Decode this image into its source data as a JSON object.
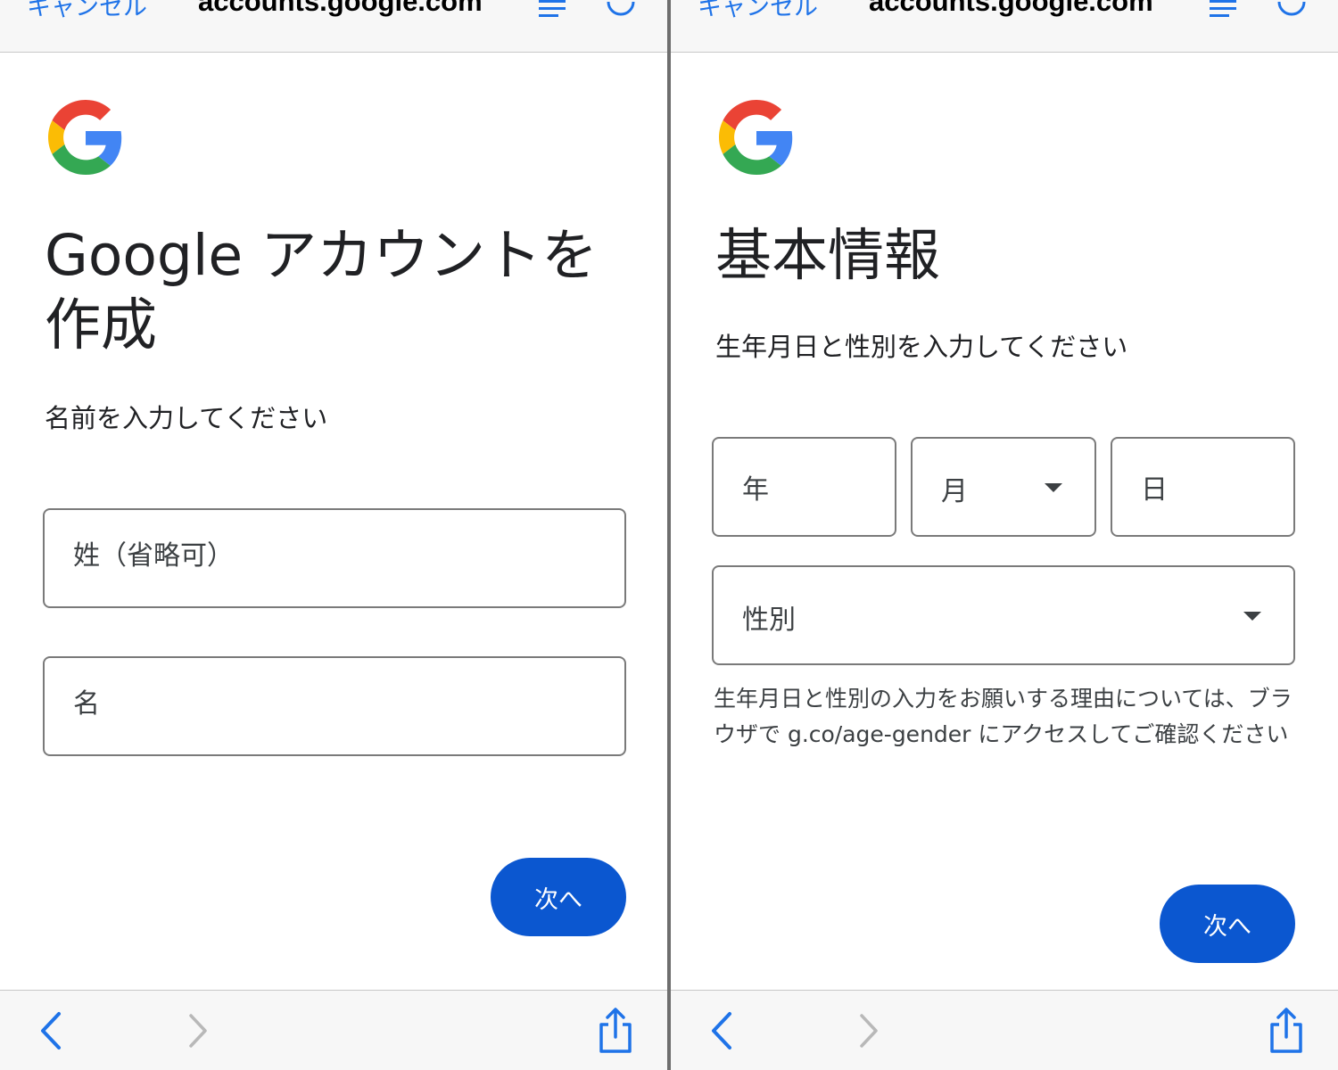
{
  "browser": {
    "cancel_label": "キャンセル",
    "url": "accounts.google.com",
    "accent_color": "#1f73e8",
    "icons": [
      "reader-icon",
      "reload-icon",
      "back-icon",
      "forward-icon",
      "share-icon"
    ]
  },
  "left": {
    "heading": "Google アカウントを作成",
    "subtitle": "名前を入力してください",
    "fields": {
      "last_name_label": "姓（省略可）",
      "first_name_label": "名"
    },
    "next_label": "次へ"
  },
  "right": {
    "heading": "基本情報",
    "subtitle": "生年月日と性別を入力してください",
    "fields": {
      "year_label": "年",
      "month_label": "月",
      "day_label": "日",
      "gender_label": "性別"
    },
    "note": "生年月日と性別の入力をお願いする理由については、ブラウザで g.co/age-gender にアクセスしてご確認ください",
    "next_label": "次へ"
  },
  "colors": {
    "button": "#0b57d0",
    "google_blue": "#4285F4",
    "google_red": "#EA4335",
    "google_yellow": "#FBBC05",
    "google_green": "#34A853"
  }
}
